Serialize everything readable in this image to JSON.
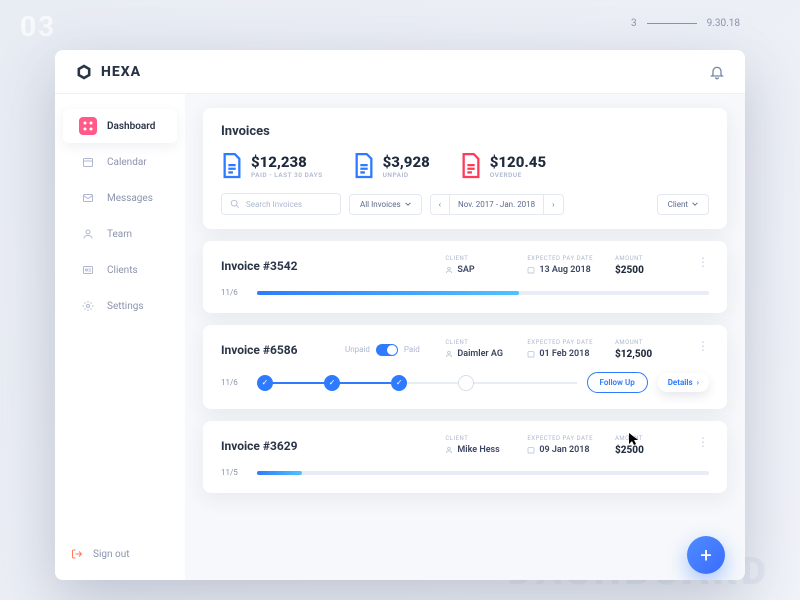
{
  "decor": {
    "page": "03",
    "meta_left": "3",
    "meta_right": "9.30.18",
    "watermark": "DASHBOARD"
  },
  "brand": {
    "name": "HEXA"
  },
  "nav": {
    "items": [
      {
        "label": "Dashboard",
        "icon": "dashboard-icon"
      },
      {
        "label": "Calendar",
        "icon": "calendar-icon"
      },
      {
        "label": "Messages",
        "icon": "messages-icon"
      },
      {
        "label": "Team",
        "icon": "team-icon"
      },
      {
        "label": "Clients",
        "icon": "clients-icon"
      },
      {
        "label": "Settings",
        "icon": "settings-icon"
      }
    ],
    "signout": "Sign out"
  },
  "summary": {
    "title": "Invoices",
    "stats": [
      {
        "value": "$12,238",
        "label": "PAID - LAST 30 DAYS",
        "color": "#2e7bff"
      },
      {
        "value": "$3,928",
        "label": "UNPAID",
        "color": "#2e7bff"
      },
      {
        "value": "$120.45",
        "label": "OVERDUE",
        "color": "#ff3b5c"
      }
    ],
    "search_placeholder": "Search Invoices",
    "filter1": "All Invoices",
    "filter_range": "Nov. 2017 - Jan. 2018",
    "filter_right": "Client",
    "meta_headers": {
      "client": "CLIENT",
      "date": "EXPECTED PAY DATE",
      "amount": "AMOUNT"
    }
  },
  "invoices": [
    {
      "title": "Invoice #3542",
      "client": "SAP",
      "date": "13 Aug 2018",
      "amount": "$2500",
      "progress_label": "11/6",
      "progress_pct": 58,
      "expanded": false
    },
    {
      "title": "Invoice #6586",
      "client": "Daimler AG",
      "date": "01 Feb 2018",
      "amount": "$12,500",
      "progress_label": "11/6",
      "expanded": true,
      "toggle": {
        "left": "Unpaid",
        "right": "Paid"
      },
      "actions": {
        "followup": "Follow Up",
        "details": "Details"
      }
    },
    {
      "title": "Invoice #3629",
      "client": "Mike Hess",
      "date": "09 Jan 2018",
      "amount": "$2500",
      "progress_label": "11/5",
      "progress_pct": 10,
      "expanded": false
    }
  ]
}
